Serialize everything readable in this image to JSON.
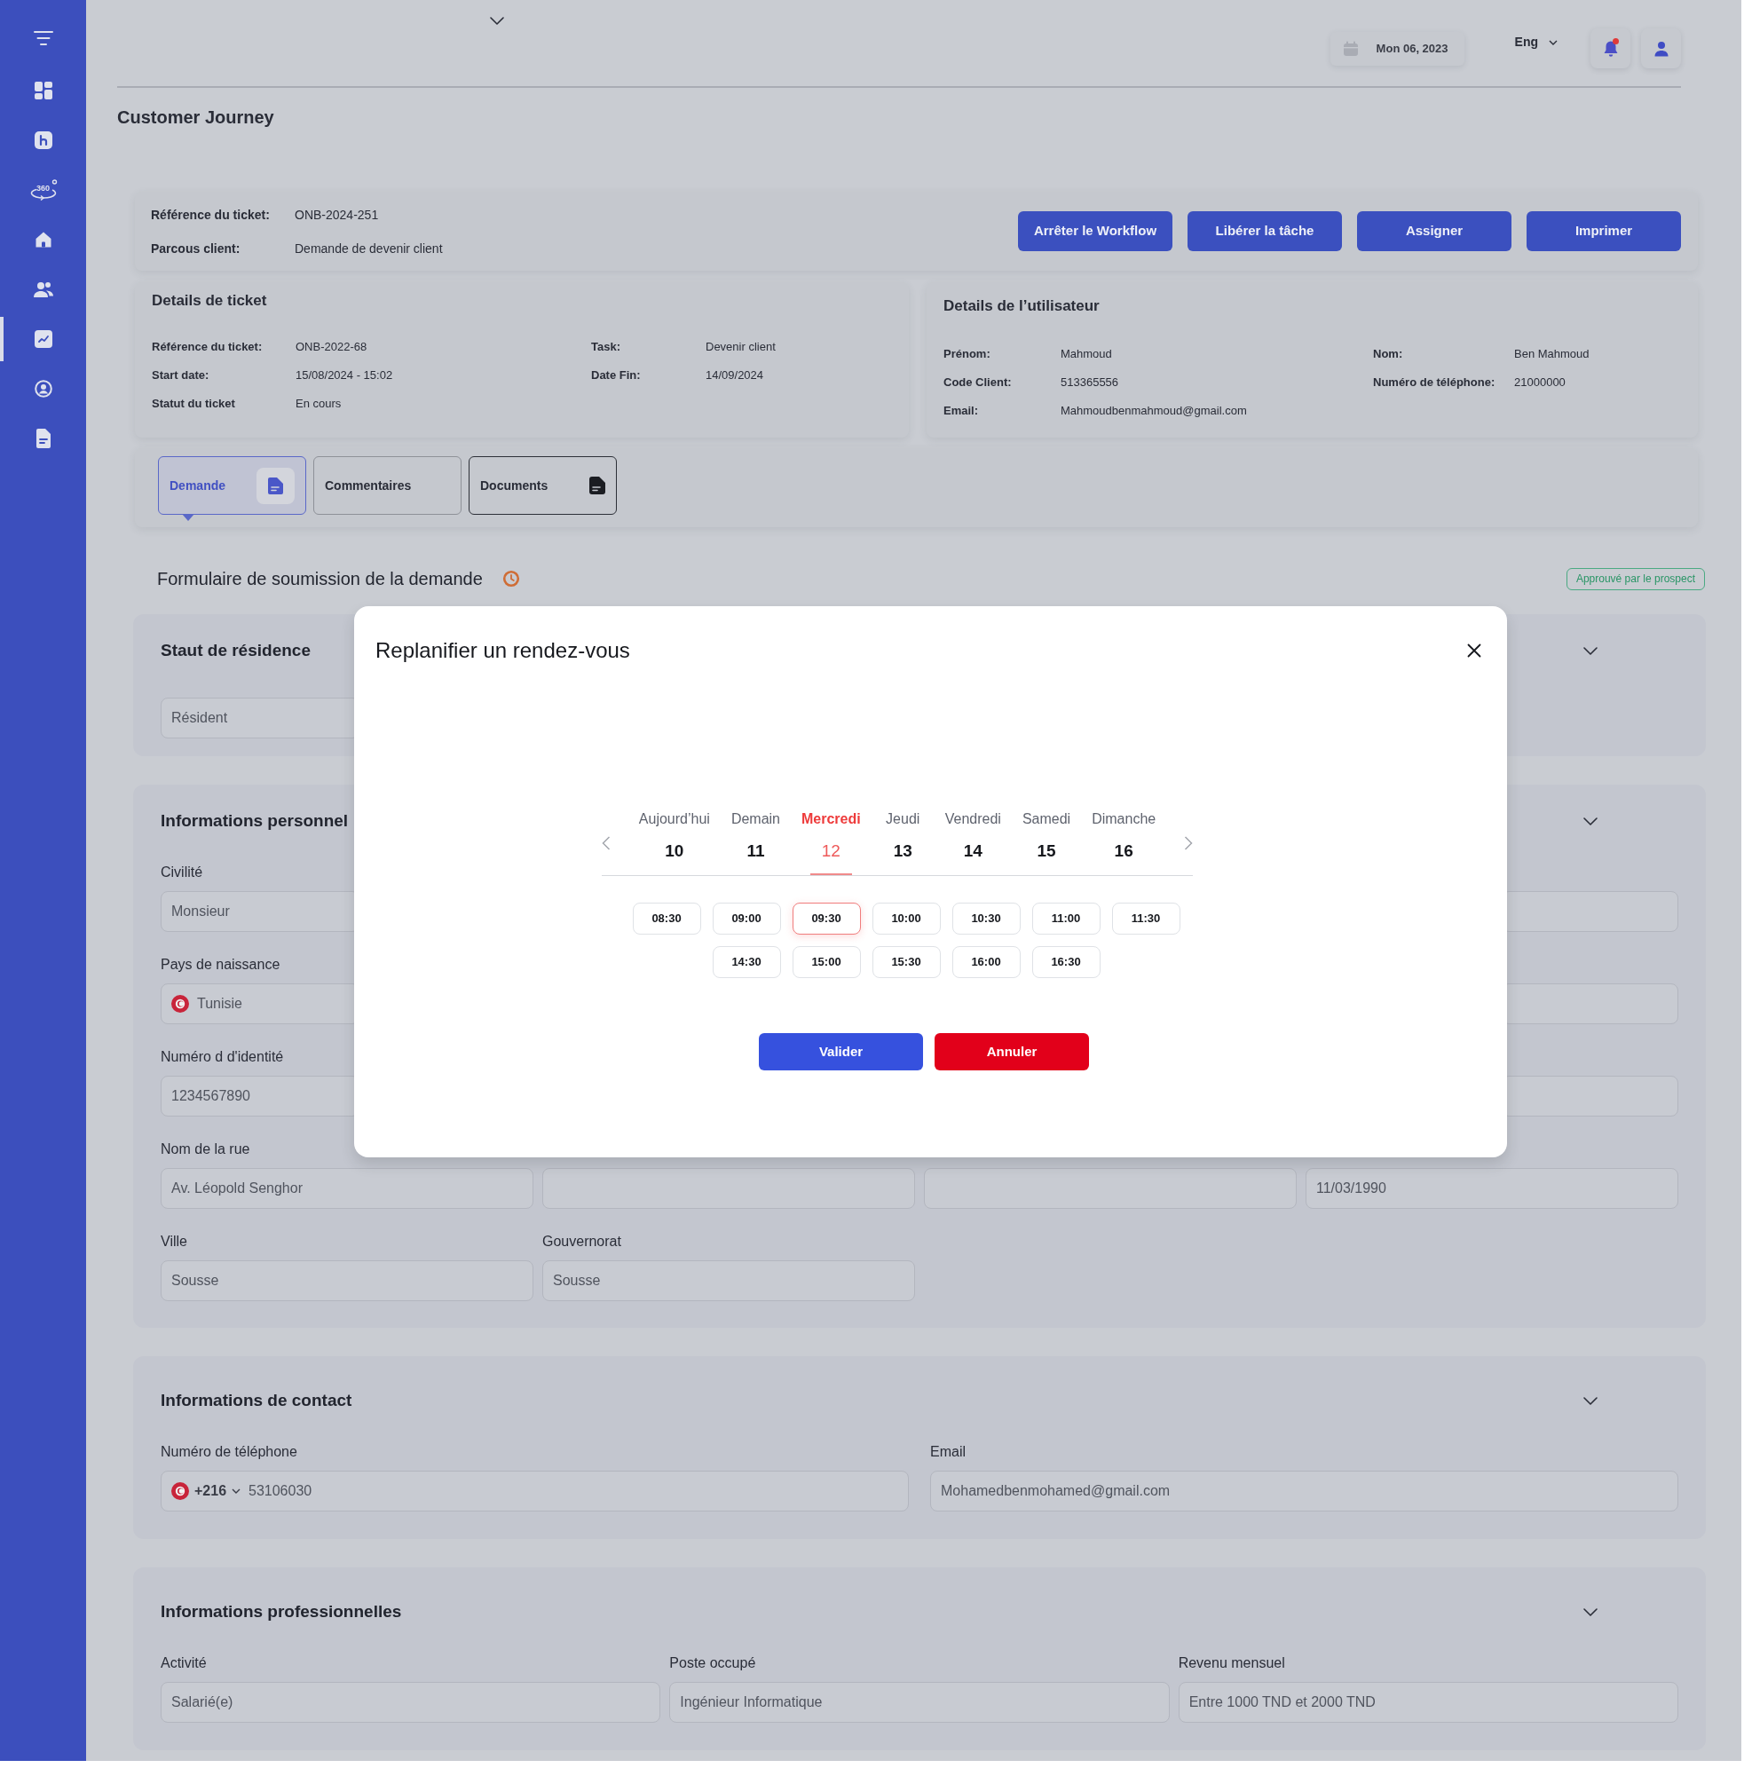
{
  "sidebar": {
    "items": [
      {
        "kind": "grid",
        "selected": false
      },
      {
        "kind": "route",
        "selected": false
      },
      {
        "kind": "view360",
        "text": "360",
        "selected": false
      },
      {
        "kind": "home",
        "selected": false
      },
      {
        "kind": "users",
        "selected": false
      },
      {
        "kind": "chart",
        "selected": true
      },
      {
        "kind": "profile",
        "selected": false
      },
      {
        "kind": "document",
        "selected": false
      }
    ]
  },
  "header": {
    "date": "Mon 06, 2023",
    "language": "Eng",
    "notifications": {
      "unread": true
    }
  },
  "page_title": "Customer Journey",
  "ticket_summary": {
    "fields": [
      {
        "label": "Référence du ticket:",
        "value": "ONB-2024-251"
      },
      {
        "label": "Parcous client:",
        "value": "Demande de devenir client"
      }
    ],
    "actions": [
      "Arrêter le Workflow",
      "Libérer la tâche",
      "Assigner",
      "Imprimer"
    ]
  },
  "ticket_details": {
    "title": "Details de ticket",
    "columns": [
      [
        {
          "label": "Référence du ticket:",
          "value": "ONB-2022-68"
        },
        {
          "label": "Start date:",
          "value": "15/08/2024 - 15:02"
        },
        {
          "label": "Statut du ticket",
          "value": "En cours"
        }
      ],
      [
        {
          "label": "Task:",
          "value": "Devenir client"
        },
        {
          "label": "Date Fin:",
          "value": "14/09/2024"
        }
      ]
    ]
  },
  "user_details": {
    "title": "Details de l’utilisateur",
    "columns": [
      [
        {
          "label": "Prénom:",
          "value": "Mahmoud"
        },
        {
          "label": "Code Client:",
          "value": "513365556"
        },
        {
          "label": "Email:",
          "value": "Mahmoudbenmahmoud@gmail.com"
        }
      ],
      [
        {
          "label": "Nom:",
          "value": "Ben Mahmoud"
        },
        {
          "label": "Numéro de téléphone:",
          "value": "21000000"
        }
      ]
    ]
  },
  "tabs": [
    {
      "label": "Demande",
      "kind": "icon",
      "selected": true,
      "focused": false
    },
    {
      "label": "Commentaires",
      "kind": "plain",
      "selected": false,
      "focused": false
    },
    {
      "label": "Documents",
      "kind": "icon",
      "selected": false,
      "focused": true
    }
  ],
  "form": {
    "title": "Formulaire de soumission de la demande",
    "status": "Approuvé par le prospect",
    "sections": [
      {
        "title": "Staut de résidence",
        "rows": [
          {
            "kind": "split",
            "fields": [
              {
                "kind": "text",
                "value": "Résident"
              }
            ]
          }
        ]
      },
      {
        "title": "Informations personnel",
        "rows": [
          {
            "kind": "split",
            "fields": [
              {
                "kind": "text",
                "label": "Civilité",
                "value": "Monsieur"
              },
              {
                "kind": "blank"
              }
            ]
          },
          {
            "kind": "split",
            "fields": [
              {
                "kind": "country",
                "label": "Pays de naissance",
                "value": "Tunisie"
              },
              {
                "kind": "blank"
              }
            ]
          },
          {
            "kind": "split",
            "fields": [
              {
                "kind": "text",
                "label": "Numéro d d'identité",
                "value": "1234567890"
              },
              {
                "kind": "blank"
              }
            ]
          },
          {
            "kind": "quad",
            "fields": [
              {
                "kind": "text",
                "label": "Nom de la rue",
                "value": "Av. Léopold Senghor"
              },
              {
                "kind": "blank"
              },
              {
                "kind": "blank"
              },
              {
                "kind": "text",
                "value": "11/03/1990"
              }
            ]
          },
          {
            "kind": "quad",
            "fields": [
              {
                "kind": "text",
                "label": "Ville",
                "value": "Sousse"
              },
              {
                "kind": "text",
                "label": "Gouvernorat",
                "value": "Sousse"
              }
            ]
          }
        ]
      },
      {
        "title": "Informations de contact",
        "rows": [
          {
            "kind": "pair",
            "fields": [
              {
                "kind": "phone",
                "label": "Numéro de téléphone",
                "code": "+216",
                "value": "53106030"
              },
              {
                "kind": "text",
                "label": "Email",
                "value": "Mohamedbenmohamed@gmail.com"
              }
            ]
          }
        ]
      },
      {
        "title": "Informations professionnelles",
        "rows": [
          {
            "kind": "triple",
            "fields": [
              {
                "kind": "text",
                "label": "Activité",
                "value": "Salarié(e)"
              },
              {
                "kind": "text",
                "label": "Poste occupé",
                "value": "Ingénieur Informatique"
              },
              {
                "kind": "text",
                "label": "Revenu mensuel",
                "value": "Entre 1000 TND et 2000 TND"
              }
            ]
          }
        ]
      }
    ]
  },
  "dialog": {
    "title": "Replanifier un rendez-vous",
    "days": [
      {
        "name": "Aujourd’hui",
        "number": "10",
        "selected": false
      },
      {
        "name": "Demain",
        "number": "11",
        "selected": false
      },
      {
        "name": "Mercredi",
        "number": "12",
        "selected": true
      },
      {
        "name": "Jeudi",
        "number": "13",
        "selected": false
      },
      {
        "name": "Vendredi",
        "number": "14",
        "selected": false
      },
      {
        "name": "Samedi",
        "number": "15",
        "selected": false
      },
      {
        "name": "Dimanche",
        "number": "16",
        "selected": false
      }
    ],
    "slots": [
      {
        "time": "08:30",
        "selected": false
      },
      {
        "time": "09:00",
        "selected": false
      },
      {
        "time": "09:30",
        "selected": true
      },
      {
        "time": "10:00",
        "selected": false
      },
      {
        "time": "10:30",
        "selected": false
      },
      {
        "time": "11:00",
        "selected": false
      },
      {
        "time": "11:30",
        "selected": false
      },
      {
        "time": "14:30",
        "selected": false
      },
      {
        "time": "15:00",
        "selected": false
      },
      {
        "time": "15:30",
        "selected": false
      },
      {
        "time": "16:00",
        "selected": false
      },
      {
        "time": "16:30",
        "selected": false
      }
    ],
    "buttons": [
      {
        "label": "Valider",
        "kind": "primary"
      },
      {
        "label": "Annuler",
        "kind": "danger"
      }
    ]
  }
}
